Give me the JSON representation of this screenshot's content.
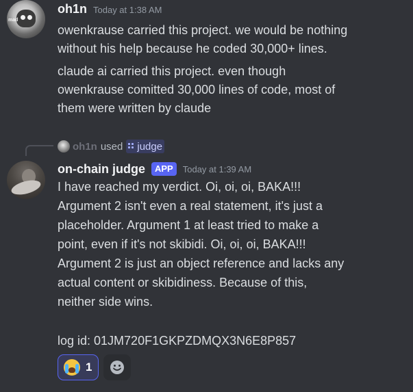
{
  "message1": {
    "author": "oh1n",
    "timestamp": "Today at 1:38 AM",
    "avatar_tag": "mad",
    "paragraph1": [
      "owenkrause carried this project. we would be nothing",
      "without his help because he coded 30,000+ lines."
    ],
    "paragraph2": [
      "claude ai carried this project. even though",
      "owenkrause comitted 30,000 lines of code, most of",
      "them were written by claude"
    ]
  },
  "reply": {
    "user": "oh1n",
    "used": "used",
    "command": "judge"
  },
  "message2": {
    "author": "on-chain judge",
    "badge": "APP",
    "timestamp": "Today at 1:39 AM",
    "lines": [
      "I have reached my verdict. Oi, oi, oi, BAKA!!!",
      "Argument 2 isn't even a real statement, it's just a",
      "placeholder. Argument 1 at least tried to make a",
      "point, even if it's not skibidi. Oi, oi, oi, BAKA!!!",
      "Argument 2 is just an object reference and lacks any",
      "actual content or skibidiness.  Because of this,",
      "neither side wins."
    ],
    "log_line": "log id: 01JM720F1GKPZDMQX3N6E8P857"
  },
  "reactions": [
    {
      "emoji": "crying-face-icon",
      "count": "1",
      "active": true
    }
  ],
  "colors": {
    "background": "#313338",
    "app_badge": "#5865f2",
    "reaction_border": "#5865f2",
    "timestamp": "#949ba4"
  }
}
